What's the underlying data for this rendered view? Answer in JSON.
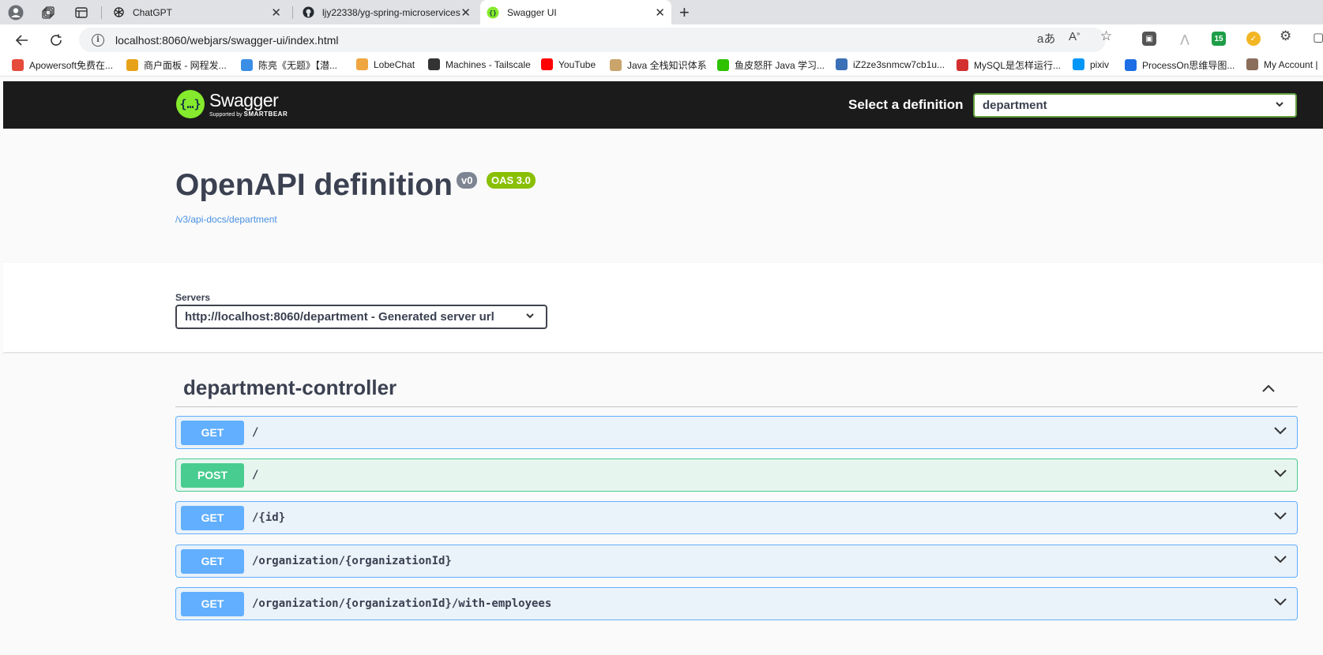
{
  "tabs": [
    {
      "title": "ChatGPT",
      "active": false
    },
    {
      "title": "ljy22338/yg-spring-microservices",
      "active": false
    },
    {
      "title": "Swagger UI",
      "active": true
    }
  ],
  "address": {
    "url": "localhost:8060/webjars/swagger-ui/index.html"
  },
  "extensions": {
    "badge_count": "15"
  },
  "bookmarks": [
    {
      "label": "Apowersoft免费在...",
      "color": "#e64a3b"
    },
    {
      "label": "商户面板 - 网程发...",
      "color": "#e8a21a"
    },
    {
      "label": "陈亮《无题》【潜...",
      "color": "#3a8ee6"
    },
    {
      "label": "LobeChat",
      "color": "#f0a640"
    },
    {
      "label": "Machines - Tailscale",
      "color": "#333333"
    },
    {
      "label": "YouTube",
      "color": "#ff0000"
    },
    {
      "label": "Java 全栈知识体系",
      "color": "#c9a46b"
    },
    {
      "label": "鱼皮怒肝 Java 学习...",
      "color": "#2dc100"
    },
    {
      "label": "iZ2ze3snmcw7cb1u...",
      "color": "#3b6fb6"
    },
    {
      "label": "MySQL是怎样运行...",
      "color": "#d32f2f"
    },
    {
      "label": "pixiv",
      "color": "#0096fa"
    },
    {
      "label": "ProcessOn思维导图...",
      "color": "#1e6ee6"
    },
    {
      "label": "My Account | ",
      "color": "#8a6d5a"
    }
  ],
  "swagger": {
    "brand": "Swagger",
    "brand_sub_prefix": "Supported by",
    "brand_sub_name": "SMARTBEAR",
    "select_definition_label": "Select a definition",
    "selected_definition": "department",
    "title": "OpenAPI definition",
    "version_badge": "v0",
    "oas_badge": "OAS 3.0",
    "api_docs_link": "/v3/api-docs/department",
    "servers_label": "Servers",
    "selected_server": "http://localhost:8060/department - Generated server url",
    "tag": "department-controller",
    "operations": [
      {
        "method": "GET",
        "path": "/"
      },
      {
        "method": "POST",
        "path": "/"
      },
      {
        "method": "GET",
        "path": "/{id}"
      },
      {
        "method": "GET",
        "path": "/organization/{organizationId}"
      },
      {
        "method": "GET",
        "path": "/organization/{organizationId}/with-employees"
      }
    ]
  }
}
